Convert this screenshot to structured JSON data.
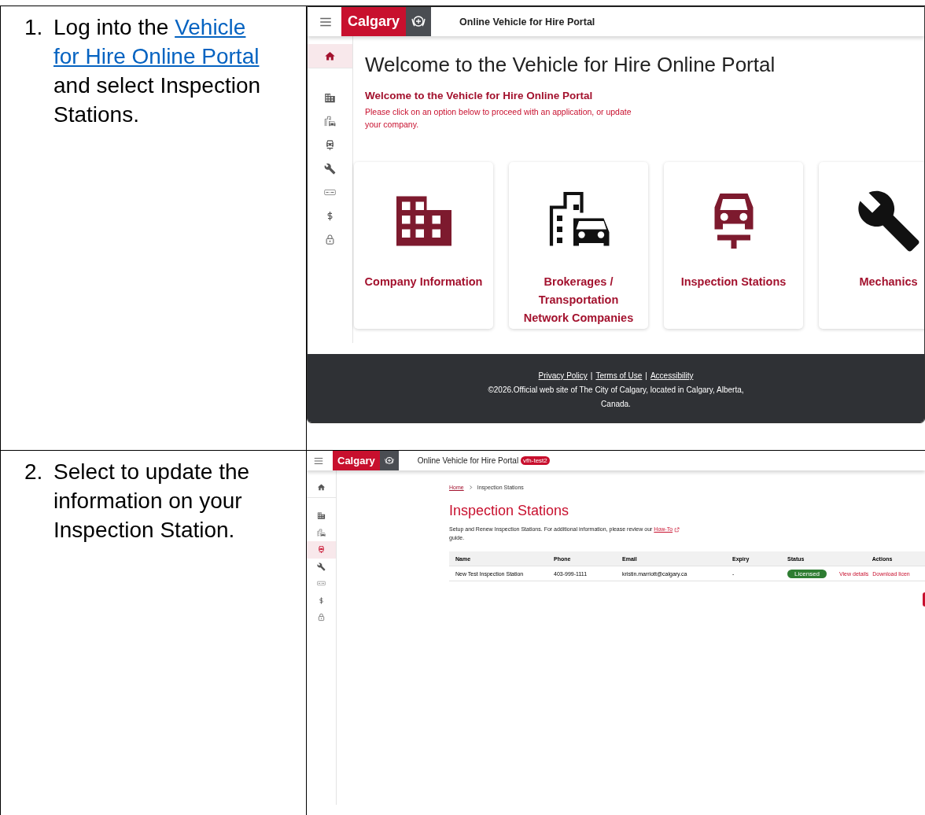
{
  "steps": [
    {
      "number": "1.",
      "instruction": [
        {
          "kind": "text",
          "text": "Log into the"
        },
        {
          "kind": "link",
          "text": "Vehicle"
        },
        {
          "kind": "link",
          "text": "for Hire Online Portal"
        },
        {
          "kind": "text",
          "text": "and select Inspection Stations."
        }
      ],
      "screen": {
        "kind": "home",
        "header": {
          "logo": "Calgary",
          "title": "Online Vehicle for Hire Portal"
        },
        "sidebar": {
          "items": [
            {
              "selected": true
            },
            {
              "selected": false
            },
            {
              "selected": false
            },
            {
              "selected": false
            },
            {
              "selected": false
            },
            {
              "selected": false
            },
            {
              "selected": false
            },
            {
              "selected": false
            }
          ]
        },
        "heading": "Welcome to the Vehicle for Hire Online Portal",
        "subheading": "Welcome to the Vehicle for Hire Online Portal",
        "intro": "Please click on an option below to proceed with an application, or update your company.",
        "cards": [
          {
            "label": "Company Information"
          },
          {
            "label": "Brokerages / Transportation Network Companies"
          },
          {
            "label": "Inspection Stations"
          },
          {
            "label": "Mechanics"
          }
        ],
        "footer": {
          "links": [
            "Privacy Policy",
            "Terms of Use",
            "Accessibility"
          ],
          "separator": "|",
          "copyright": "©2026.Official web site of The City of Calgary, located in Calgary, Alberta, Canada."
        }
      }
    },
    {
      "number": "2.",
      "instruction": [
        {
          "kind": "text",
          "text": "Select to update the information on your Inspection Station."
        }
      ],
      "screen": {
        "kind": "list",
        "header": {
          "logo": "Calgary",
          "title": "Online Vehicle for Hire Portal",
          "badge": "vfh-test2"
        },
        "sidebar": {
          "items": [
            {
              "selected": false
            },
            {
              "selected": false
            },
            {
              "selected": false
            },
            {
              "selected": true
            },
            {
              "selected": false
            },
            {
              "selected": false
            },
            {
              "selected": false
            },
            {
              "selected": false
            }
          ]
        },
        "breadcrumb": [
          {
            "kind": "link",
            "text": "Home"
          },
          {
            "kind": "current",
            "text": "Inspection Stations"
          }
        ],
        "heading": "Inspection Stations",
        "description": {
          "before": "Setup and Renew Inspection Stations. For additional information, please review our",
          "link": "How-To",
          "after": "guide."
        },
        "table": {
          "columns": [
            "Name",
            "Phone",
            "Email",
            "Expiry",
            "Status",
            "Actions"
          ],
          "rows": [
            {
              "cells": [
                "New Test Inspection Station",
                "403-999-1111",
                "kristin.marriott@calgary.ca",
                "-"
              ],
              "status": "Licensed",
              "actions": [
                "View details",
                "Download licen"
              ]
            }
          ]
        }
      }
    }
  ]
}
